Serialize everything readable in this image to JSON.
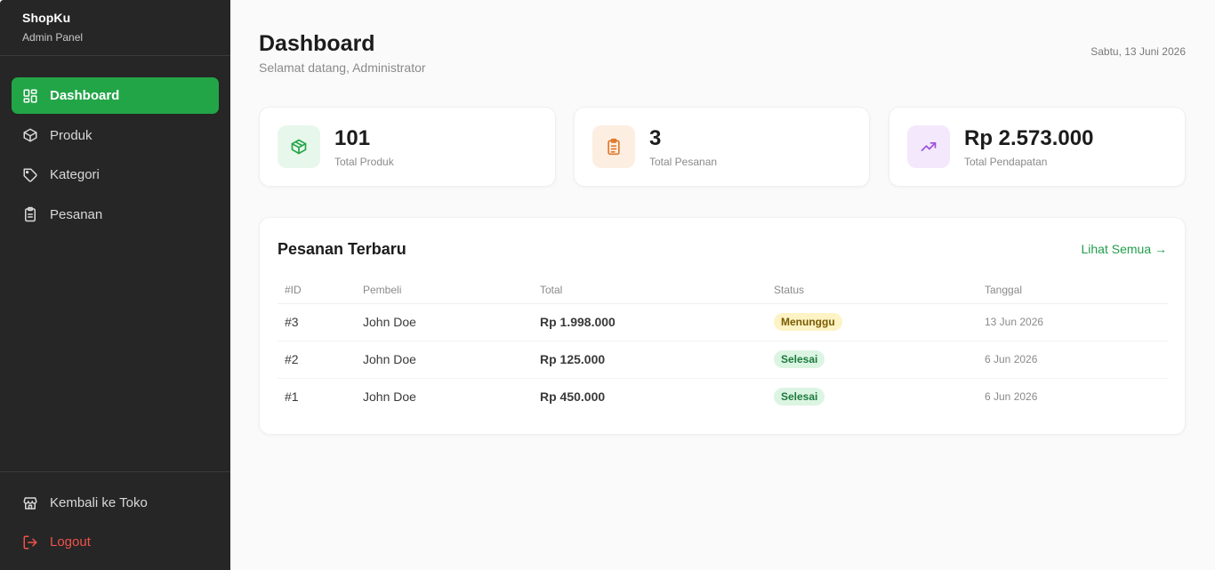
{
  "brand": {
    "name": "ShopKu",
    "subtitle": "Admin Panel"
  },
  "nav": [
    {
      "label": "Dashboard",
      "icon": "grid-icon",
      "active": true
    },
    {
      "label": "Produk",
      "icon": "box-icon",
      "active": false
    },
    {
      "label": "Kategori",
      "icon": "tag-icon",
      "active": false
    },
    {
      "label": "Pesanan",
      "icon": "clipboard-icon",
      "active": false
    }
  ],
  "bottom_nav": [
    {
      "label": "Kembali ke Toko",
      "icon": "store-icon"
    },
    {
      "label": "Logout",
      "icon": "logout-icon"
    }
  ],
  "header": {
    "title": "Dashboard",
    "subtitle": "Selamat datang, Administrator",
    "date": "Sabtu, 13 Juni 2026"
  },
  "stats": [
    {
      "value": "101",
      "label": "Total Produk",
      "icon": "box-icon",
      "color": "#22a547",
      "bg": "#e8f7ec"
    },
    {
      "value": "3",
      "label": "Total Pesanan",
      "icon": "clipboard-icon",
      "color": "#e07a2e",
      "bg": "#fdeee2"
    },
    {
      "value": "Rp 2.573.000",
      "label": "Total Pendapatan",
      "icon": "trending-up-icon",
      "color": "#9b4de0",
      "bg": "#f3e8fc"
    }
  ],
  "orders": {
    "title": "Pesanan Terbaru",
    "view_all": "Lihat Semua →",
    "columns": [
      "#ID",
      "Pembeli",
      "Total",
      "Status",
      "Tanggal"
    ],
    "rows": [
      {
        "id": "#3",
        "buyer": "John Doe",
        "total": "Rp 1.998.000",
        "status": "Menunggu",
        "date": "13 Jun 2026"
      },
      {
        "id": "#2",
        "buyer": "John Doe",
        "total": "Rp 125.000",
        "status": "Selesai",
        "date": "6 Jun 2026"
      },
      {
        "id": "#1",
        "buyer": "John Doe",
        "total": "Rp 450.000",
        "status": "Selesai",
        "date": "6 Jun 2026"
      }
    ]
  },
  "colors": {
    "accent": "#22a547",
    "sidebar": "#262626",
    "logout": "#f0524a",
    "pending": "#fdf3c4",
    "done": "#dcf5e3"
  }
}
